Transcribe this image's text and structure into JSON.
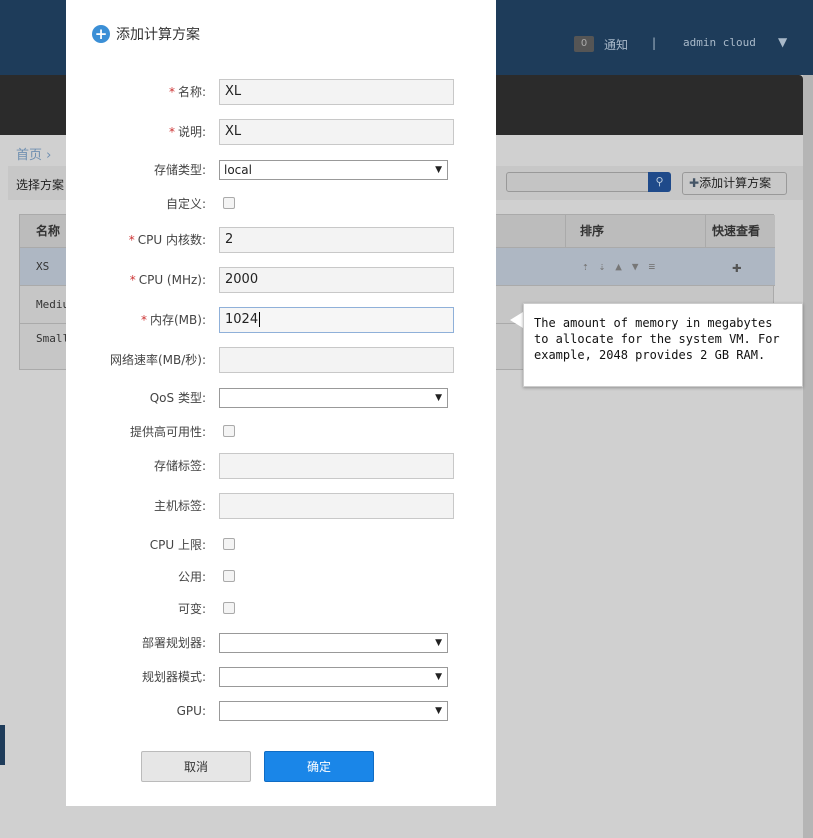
{
  "header": {
    "notification_count": "0",
    "notification_label": "通知",
    "separator": "|",
    "user": "admin cloud",
    "user_menu_icon": "caret-down-icon"
  },
  "breadcrumb": {
    "home": "首页",
    "sep": "›"
  },
  "toolbar": {
    "select_label": "选择方案",
    "search_placeholder": "",
    "add_button": "添加计算方案"
  },
  "table": {
    "headers": {
      "name": "名称",
      "sort": "排序",
      "quickview": "快速查看"
    },
    "rows": [
      "XS",
      "Medium",
      "Small"
    ]
  },
  "dialog": {
    "title": "添加计算方案",
    "fields": {
      "name": {
        "label": "名称:",
        "value": "XL"
      },
      "description": {
        "label": "说明:",
        "value": "XL"
      },
      "storage_type": {
        "label": "存储类型:",
        "value": "local"
      },
      "custom": {
        "label": "自定义:"
      },
      "cpu_cores": {
        "label": "CPU 内核数:",
        "value": "2"
      },
      "cpu_mhz": {
        "label": "CPU (MHz):",
        "value": "2000"
      },
      "memory": {
        "label": "内存(MB):",
        "value": "1024"
      },
      "network_rate": {
        "label": "网络速率(MB/秒):",
        "value": ""
      },
      "qos_type": {
        "label": "QoS 类型:",
        "value": ""
      },
      "ha": {
        "label": "提供高可用性:"
      },
      "storage_tags": {
        "label": "存储标签:",
        "value": ""
      },
      "host_tags": {
        "label": "主机标签:",
        "value": ""
      },
      "cpu_cap": {
        "label": "CPU 上限:"
      },
      "public": {
        "label": "公用:"
      },
      "volatile": {
        "label": "可变:"
      },
      "planner": {
        "label": "部署规划器:",
        "value": ""
      },
      "planner_mode": {
        "label": "规划器模式:",
        "value": ""
      },
      "gpu": {
        "label": "GPU:",
        "value": ""
      }
    },
    "cancel": "取消",
    "ok": "确定"
  },
  "tooltip": "The amount of memory in megabytes to allocate for the system VM. For example, 2048 provides 2 GB RAM."
}
